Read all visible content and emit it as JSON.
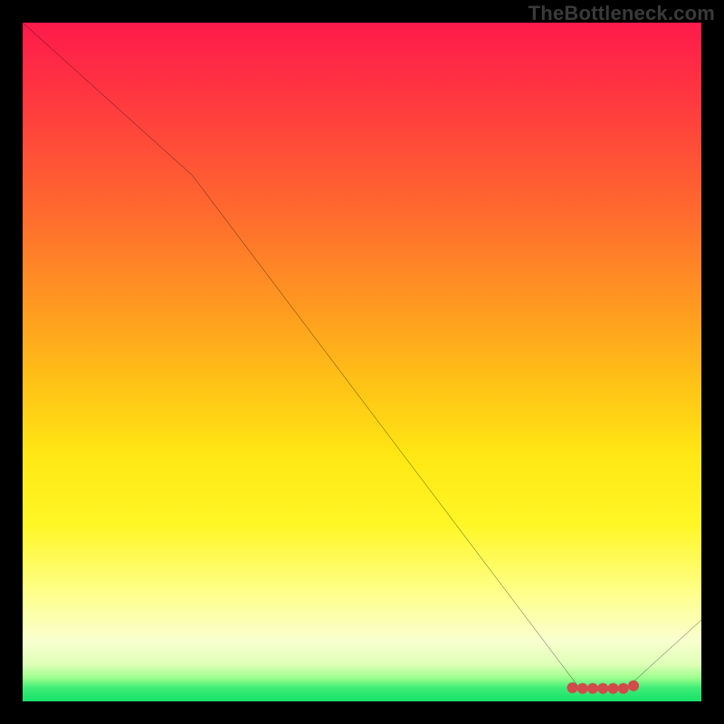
{
  "watermark": "TheBottleneck.com",
  "chart_data": {
    "type": "line",
    "title": "",
    "xlabel": "",
    "ylabel": "",
    "xlim": [
      0,
      100
    ],
    "ylim": [
      0,
      100
    ],
    "grid": false,
    "x": [
      0,
      25,
      82,
      89,
      100
    ],
    "values": [
      100,
      77.5,
      2,
      2,
      12
    ],
    "markers": {
      "x": [
        81,
        82.5,
        84,
        85.5,
        87,
        88.5,
        90
      ],
      "values": [
        2,
        1.9,
        1.9,
        1.9,
        1.9,
        1.9,
        2.3
      ],
      "color": "#d24a4a"
    },
    "line_color": "#000000",
    "gradient_stops": [
      {
        "pos": 0,
        "color": "#ff1a4b"
      },
      {
        "pos": 12,
        "color": "#ff3a3f"
      },
      {
        "pos": 28,
        "color": "#ff6a2e"
      },
      {
        "pos": 42,
        "color": "#ff9a20"
      },
      {
        "pos": 54,
        "color": "#ffc516"
      },
      {
        "pos": 64,
        "color": "#ffe814"
      },
      {
        "pos": 74,
        "color": "#fff626"
      },
      {
        "pos": 84,
        "color": "#feff8a"
      },
      {
        "pos": 91,
        "color": "#f9ffcf"
      },
      {
        "pos": 94.5,
        "color": "#dfffb8"
      },
      {
        "pos": 96.5,
        "color": "#9fff8f"
      },
      {
        "pos": 98,
        "color": "#3fed77"
      },
      {
        "pos": 100,
        "color": "#17e06a"
      }
    ]
  }
}
